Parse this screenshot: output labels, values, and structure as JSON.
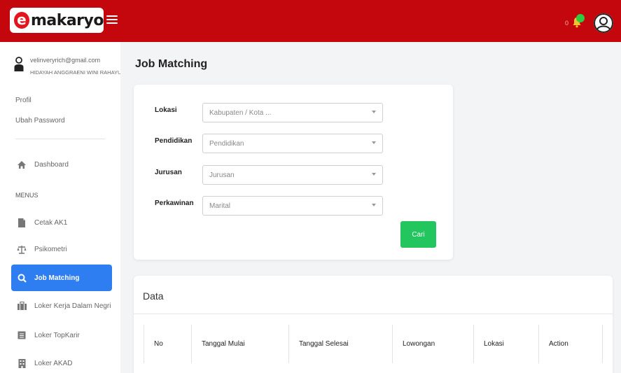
{
  "app": {
    "logo_letter": "e",
    "logo_text": "makaryo",
    "notification_count": "0",
    "brand_color": "#c4060d"
  },
  "user": {
    "email": "velinveryrich@gmail.com",
    "name": "HIDAYAH ANGGRAENI WINI RAHAYU"
  },
  "sidebar": {
    "links": [
      {
        "label": "Profil"
      },
      {
        "label": "Ubah Password"
      }
    ],
    "dashboard_label": "Dashboard",
    "menus_title": "MENUS",
    "items": [
      {
        "label": "Cetak AK1",
        "icon": "file-icon"
      },
      {
        "label": "Psikometri",
        "icon": "scale-icon"
      },
      {
        "label": "Job Matching",
        "icon": "search-icon",
        "active": true
      },
      {
        "label": "Loker Kerja Dalam Negri",
        "icon": "briefcase-icon"
      },
      {
        "label": "Loker TopKarir",
        "icon": "list-box-icon"
      },
      {
        "label": "Loker AKAD",
        "icon": "building-icon"
      }
    ]
  },
  "main": {
    "title": "Job Matching",
    "filters": [
      {
        "label": "Lokasi",
        "placeholder": "Kabupaten / Kota ..."
      },
      {
        "label": "Pendidikan",
        "placeholder": "Pendidikan"
      },
      {
        "label": "Jurusan",
        "placeholder": "Jurusan"
      },
      {
        "label": "Perkawinan",
        "placeholder": "Marital"
      }
    ],
    "search_button": "Cari",
    "accent_green": "#22c55e",
    "data_title": "Data",
    "table_headers": [
      "No",
      "Tanggal Mulai",
      "Tanggal Selesai",
      "Lowongan",
      "Lokasi",
      "Action"
    ]
  }
}
